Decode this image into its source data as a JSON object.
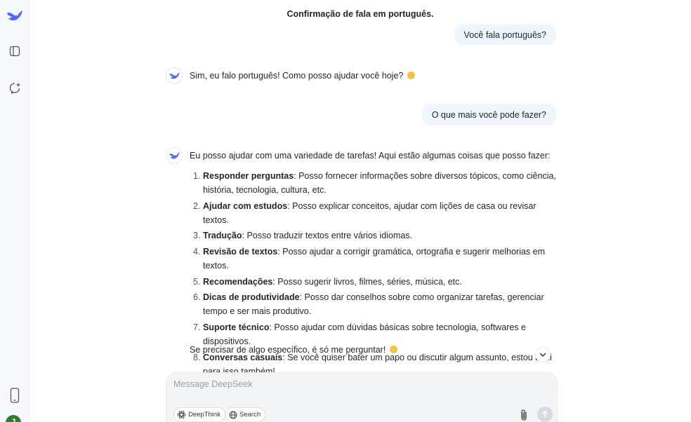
{
  "header": {
    "title": "Confirmação de fala em português."
  },
  "messages": {
    "user1": "Você fala português?",
    "ai1": "Sim, eu falo português! Como posso ajudar você hoje?",
    "user2": "O que mais você pode fazer?",
    "ai2_intro": "Eu posso ajudar com uma variedade de tarefas! Aqui estão algumas coisas que posso fazer:",
    "ai2_items": [
      {
        "num": "1.",
        "bold": "Responder perguntas",
        "text": ": Posso fornecer informações sobre diversos tópicos, como ciência, história, tecnologia, cultura, etc."
      },
      {
        "num": "2.",
        "bold": "Ajudar com estudos",
        "text": ": Posso explicar conceitos, ajudar com lições de casa ou revisar textos."
      },
      {
        "num": "3.",
        "bold": "Tradução",
        "text": ": Posso traduzir textos entre vários idiomas."
      },
      {
        "num": "4.",
        "bold": "Revisão de textos",
        "text": ": Posso ajudar a corrigir gramática, ortografia e sugerir melhorias em textos."
      },
      {
        "num": "5.",
        "bold": "Recomendações",
        "text": ": Posso sugerir livros, filmes, séries, música, etc."
      },
      {
        "num": "6.",
        "bold": "Dicas de produtividade",
        "text": ": Posso dar conselhos sobre como organizar tarefas, gerenciar tempo e ser mais produtivo."
      },
      {
        "num": "7.",
        "bold": "Suporte técnico",
        "text": ": Posso ajudar com dúvidas básicas sobre tecnologia, softwares e dispositivos."
      },
      {
        "num": "8.",
        "bold": "Conversas casuais",
        "text": ": Se você quiser bater um papo ou discutir algum assunto, estou aqui para isso também!"
      }
    ],
    "ai2_outro": "Se precisar de algo específico, é só me perguntar!"
  },
  "composer": {
    "placeholder": "Message DeepSeek",
    "deepthink_label": "DeepThink",
    "search_label": "Search"
  },
  "sidebar": {
    "avatar_letter": "J"
  },
  "colors": {
    "brand": "#4d6bfe",
    "user_bubble": "#eff6ff",
    "avatar_bg": "#2e7d32"
  },
  "icons": [
    "deepseek-logo-icon",
    "sidebar-toggle-icon",
    "new-chat-icon",
    "phone-icon",
    "chevron-down-icon",
    "atom-icon",
    "globe-icon",
    "paperclip-icon",
    "arrow-up-icon",
    "smile-emoji-icon"
  ]
}
